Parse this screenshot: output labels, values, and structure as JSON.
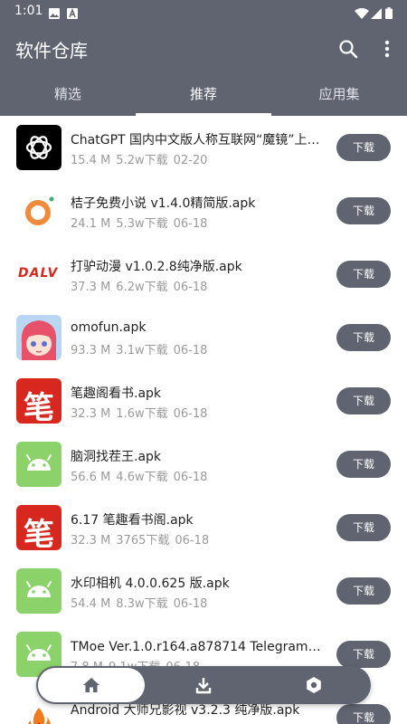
{
  "status_bar": {
    "time": "1:01",
    "icons": [
      "image-icon",
      "a-icon",
      "wifi-icon",
      "signal-icon",
      "battery-icon"
    ]
  },
  "app_bar": {
    "title": "软件仓库",
    "icons": [
      "search-icon",
      "more-vert-icon"
    ]
  },
  "tabs": [
    {
      "label": "精选",
      "active": false
    },
    {
      "label": "推荐",
      "active": true
    },
    {
      "label": "应用集",
      "active": false
    }
  ],
  "apps": [
    {
      "name": "ChatGPT 国内中文版人称互联网“魔镜”上知...",
      "size": "15.4 M",
      "downloads": "5.2w下载",
      "date": "02-20",
      "icon": "chatgpt-logo-icon",
      "download_label": "下载"
    },
    {
      "name": "桔子免费小说 v1.4.0精简版.apk",
      "size": "24.1 M",
      "downloads": "5.3w下载",
      "date": "06-18",
      "icon": "orange-ring-icon",
      "download_label": "下载"
    },
    {
      "name": "打驴动漫 v1.0.2.8纯净版.apk",
      "size": "37.3 M",
      "downloads": "6.2w下载",
      "date": "06-18",
      "icon": "dalv-logo-icon",
      "logo_text": "DALV",
      "download_label": "下载"
    },
    {
      "name": "omofun.apk",
      "size": "93.3 M",
      "downloads": "3.1w下载",
      "date": "06-18",
      "icon": "anime-girl-icon",
      "download_label": "下载"
    },
    {
      "name": "笔趣阁看书.apk",
      "size": "32.3 M",
      "downloads": "1.6w下载",
      "date": "06-18",
      "icon": "bi-character-icon",
      "logo_text": "笔",
      "download_label": "下载"
    },
    {
      "name": "脑洞找茬王.apk",
      "size": "56.6 M",
      "downloads": "4.6w下载",
      "date": "06-18",
      "icon": "android-icon",
      "download_label": "下载"
    },
    {
      "name": "6.17 笔趣看书阁.apk",
      "size": "32.3 M",
      "downloads": "3765下载",
      "date": "06-18",
      "icon": "bi-character-icon",
      "logo_text": "笔",
      "download_label": "下载"
    },
    {
      "name": "水印相机 4.0.0.625 版.apk",
      "size": "54.4 M",
      "downloads": "8.3w下载",
      "date": "06-18",
      "icon": "android-icon",
      "download_label": "下载"
    },
    {
      "name": "TMoe Ver.1.0.r164.a878714 Telegram增强...",
      "size": "7.8 M",
      "downloads": "9.1w下载",
      "date": "06-18",
      "icon": "android-icon",
      "download_label": "下载"
    },
    {
      "name": "Android 大师兄影视 v3.2.3 纯净版.apk",
      "size": "",
      "downloads": "",
      "date": "",
      "icon": "fire-logo-icon",
      "download_label": "下载"
    }
  ],
  "bottom_nav": {
    "items": [
      "home-icon",
      "download-icon",
      "settings-icon"
    ],
    "active": "home-icon"
  },
  "colors": {
    "primary": "#5f6470",
    "android_green": "#8bd26a",
    "brand_red": "#d8271e"
  }
}
